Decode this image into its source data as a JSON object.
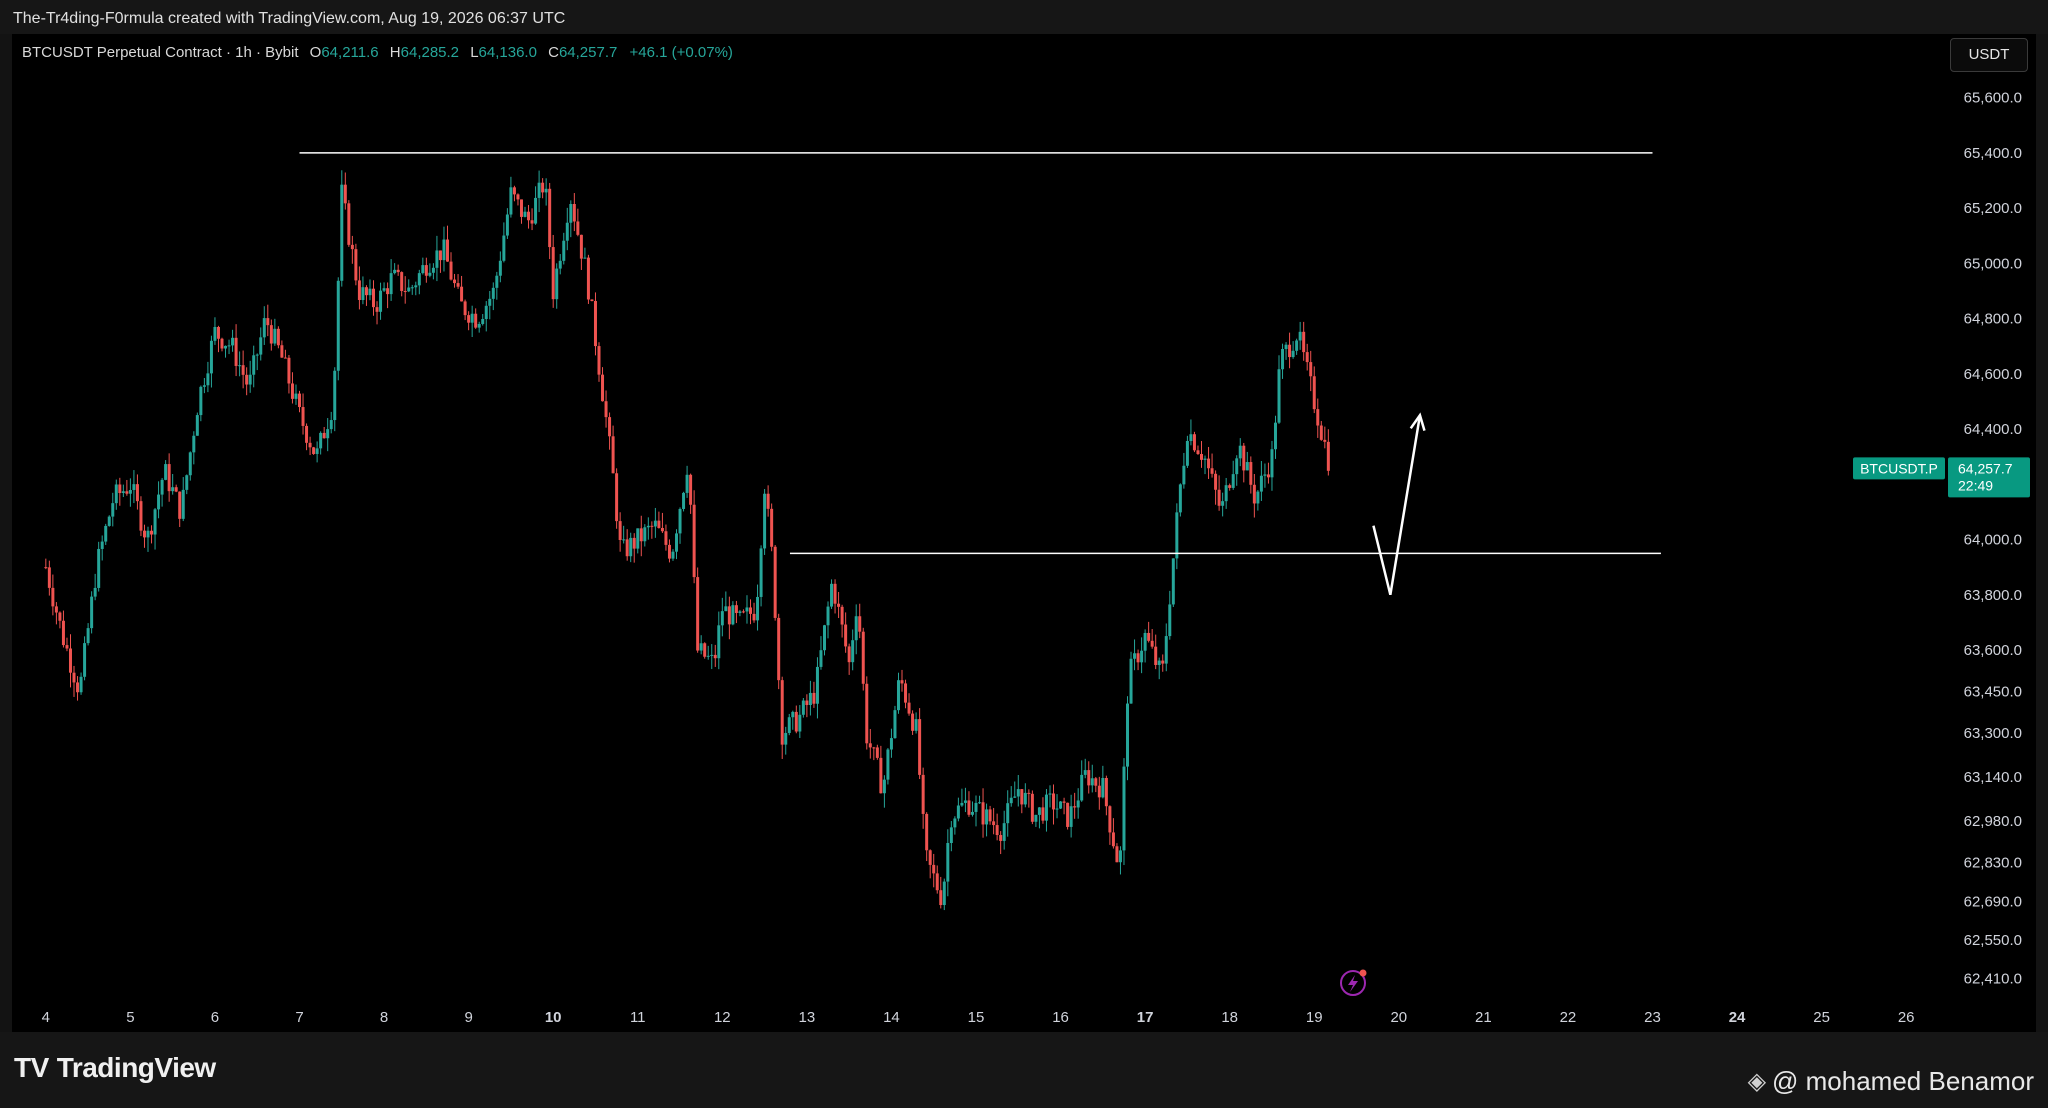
{
  "header": {
    "attribution": "The-Tr4ding-F0rmula created with TradingView.com, Aug 19, 2026 06:37 UTC"
  },
  "legend": {
    "symbol": "BTCUSDT Perpetual Contract · 1h · Bybit",
    "open_key": "O",
    "open": "64,211.6",
    "high_key": "H",
    "high": "64,285.2",
    "low_key": "L",
    "low": "64,136.0",
    "close_key": "C",
    "close": "64,257.7",
    "change": "+46.1 (+0.07%)"
  },
  "currency_button": "USDT",
  "price_tag": {
    "symbol": "BTCUSDT.P",
    "price": "64,257.7",
    "countdown": "22:49"
  },
  "footer": {
    "brand": "TradingView",
    "watermark": "@ mohamed Benamor"
  },
  "colors": {
    "up": "#26a69a",
    "down": "#ef5350",
    "background": "#000000",
    "tag": "#089981",
    "annotation": "#ffffff"
  },
  "chart_data": {
    "type": "candlestick",
    "x_tick_labels": [
      "4",
      "5",
      "6",
      "7",
      "8",
      "9",
      "10",
      "11",
      "12",
      "13",
      "14",
      "15",
      "16",
      "17",
      "18",
      "19",
      "20",
      "21",
      "22",
      "23",
      "24",
      "25",
      "26"
    ],
    "bold_x_ticks": [
      "10",
      "17",
      "24"
    ],
    "y_tick_labels": [
      "65,600.0",
      "65,400.0",
      "65,200.0",
      "65,000.0",
      "64,800.0",
      "64,600.0",
      "64,400.0",
      "64,000.0",
      "63,800.0",
      "63,600.0",
      "63,450.0",
      "63,300.0",
      "63,140.0",
      "62,980.0",
      "62,830.0",
      "62,690.0",
      "62,550.0",
      "62,410.0"
    ],
    "y_tick_values": [
      65600,
      65400,
      65200,
      65000,
      64800,
      64600,
      64400,
      64000,
      63800,
      63600,
      63450,
      63300,
      63140,
      62980,
      62830,
      62690,
      62550,
      62410
    ],
    "price_path": [
      [
        4,
        63900
      ],
      [
        4.2,
        63650
      ],
      [
        4.4,
        63450
      ],
      [
        4.6,
        63900
      ],
      [
        4.8,
        64150
      ],
      [
        5,
        64200
      ],
      [
        5.2,
        64000
      ],
      [
        5.4,
        64250
      ],
      [
        5.6,
        64100
      ],
      [
        5.8,
        64500
      ],
      [
        6,
        64750
      ],
      [
        6.2,
        64700
      ],
      [
        6.4,
        64550
      ],
      [
        6.6,
        64800
      ],
      [
        6.8,
        64650
      ],
      [
        7,
        64450
      ],
      [
        7.2,
        64300
      ],
      [
        7.4,
        64500
      ],
      [
        7.5,
        65250
      ],
      [
        7.7,
        64900
      ],
      [
        7.9,
        64850
      ],
      [
        8.1,
        64950
      ],
      [
        8.3,
        64900
      ],
      [
        8.5,
        65000
      ],
      [
        8.7,
        65050
      ],
      [
        8.9,
        64850
      ],
      [
        9.1,
        64800
      ],
      [
        9.3,
        64900
      ],
      [
        9.5,
        65250
      ],
      [
        9.7,
        65150
      ],
      [
        9.9,
        65300
      ],
      [
        10,
        64900
      ],
      [
        10.2,
        65250
      ],
      [
        10.4,
        64950
      ],
      [
        10.6,
        64500
      ],
      [
        10.7,
        64250
      ],
      [
        10.8,
        63950
      ],
      [
        11,
        64000
      ],
      [
        11.2,
        64050
      ],
      [
        11.4,
        63950
      ],
      [
        11.6,
        64300
      ],
      [
        11.7,
        63600
      ],
      [
        11.9,
        63550
      ],
      [
        12,
        63750
      ],
      [
        12.2,
        63700
      ],
      [
        12.4,
        63750
      ],
      [
        12.5,
        64200
      ],
      [
        12.6,
        63900
      ],
      [
        12.7,
        63300
      ],
      [
        12.9,
        63350
      ],
      [
        13.1,
        63450
      ],
      [
        13.3,
        63850
      ],
      [
        13.5,
        63550
      ],
      [
        13.6,
        63800
      ],
      [
        13.7,
        63300
      ],
      [
        13.9,
        63100
      ],
      [
        14.1,
        63500
      ],
      [
        14.3,
        63300
      ],
      [
        14.4,
        62850
      ],
      [
        14.6,
        62700
      ],
      [
        14.7,
        63000
      ],
      [
        14.9,
        63050
      ],
      [
        15.1,
        63000
      ],
      [
        15.3,
        62950
      ],
      [
        15.5,
        63100
      ],
      [
        15.7,
        63000
      ],
      [
        15.9,
        63050
      ],
      [
        16.1,
        62990
      ],
      [
        16.3,
        63150
      ],
      [
        16.5,
        63100
      ],
      [
        16.7,
        62800
      ],
      [
        16.8,
        63500
      ],
      [
        17,
        63650
      ],
      [
        17.2,
        63500
      ],
      [
        17.4,
        64150
      ],
      [
        17.5,
        64400
      ],
      [
        17.7,
        64300
      ],
      [
        17.9,
        64100
      ],
      [
        18.1,
        64350
      ],
      [
        18.3,
        64150
      ],
      [
        18.5,
        64300
      ],
      [
        18.6,
        64650
      ],
      [
        18.8,
        64750
      ],
      [
        19,
        64500
      ],
      [
        19.2,
        64250
      ]
    ],
    "horizontal_lines": [
      {
        "price": 65400,
        "from_day": 7,
        "to_day": 23
      },
      {
        "price": 63950,
        "from_day": 12.8,
        "to_day": 23.1
      }
    ],
    "projection_arrow": [
      [
        19.7,
        64050
      ],
      [
        19.9,
        63800
      ],
      [
        20.25,
        64450
      ]
    ],
    "ylim": [
      62340,
      65700
    ],
    "xlim": [
      3.6,
      26.4
    ]
  }
}
